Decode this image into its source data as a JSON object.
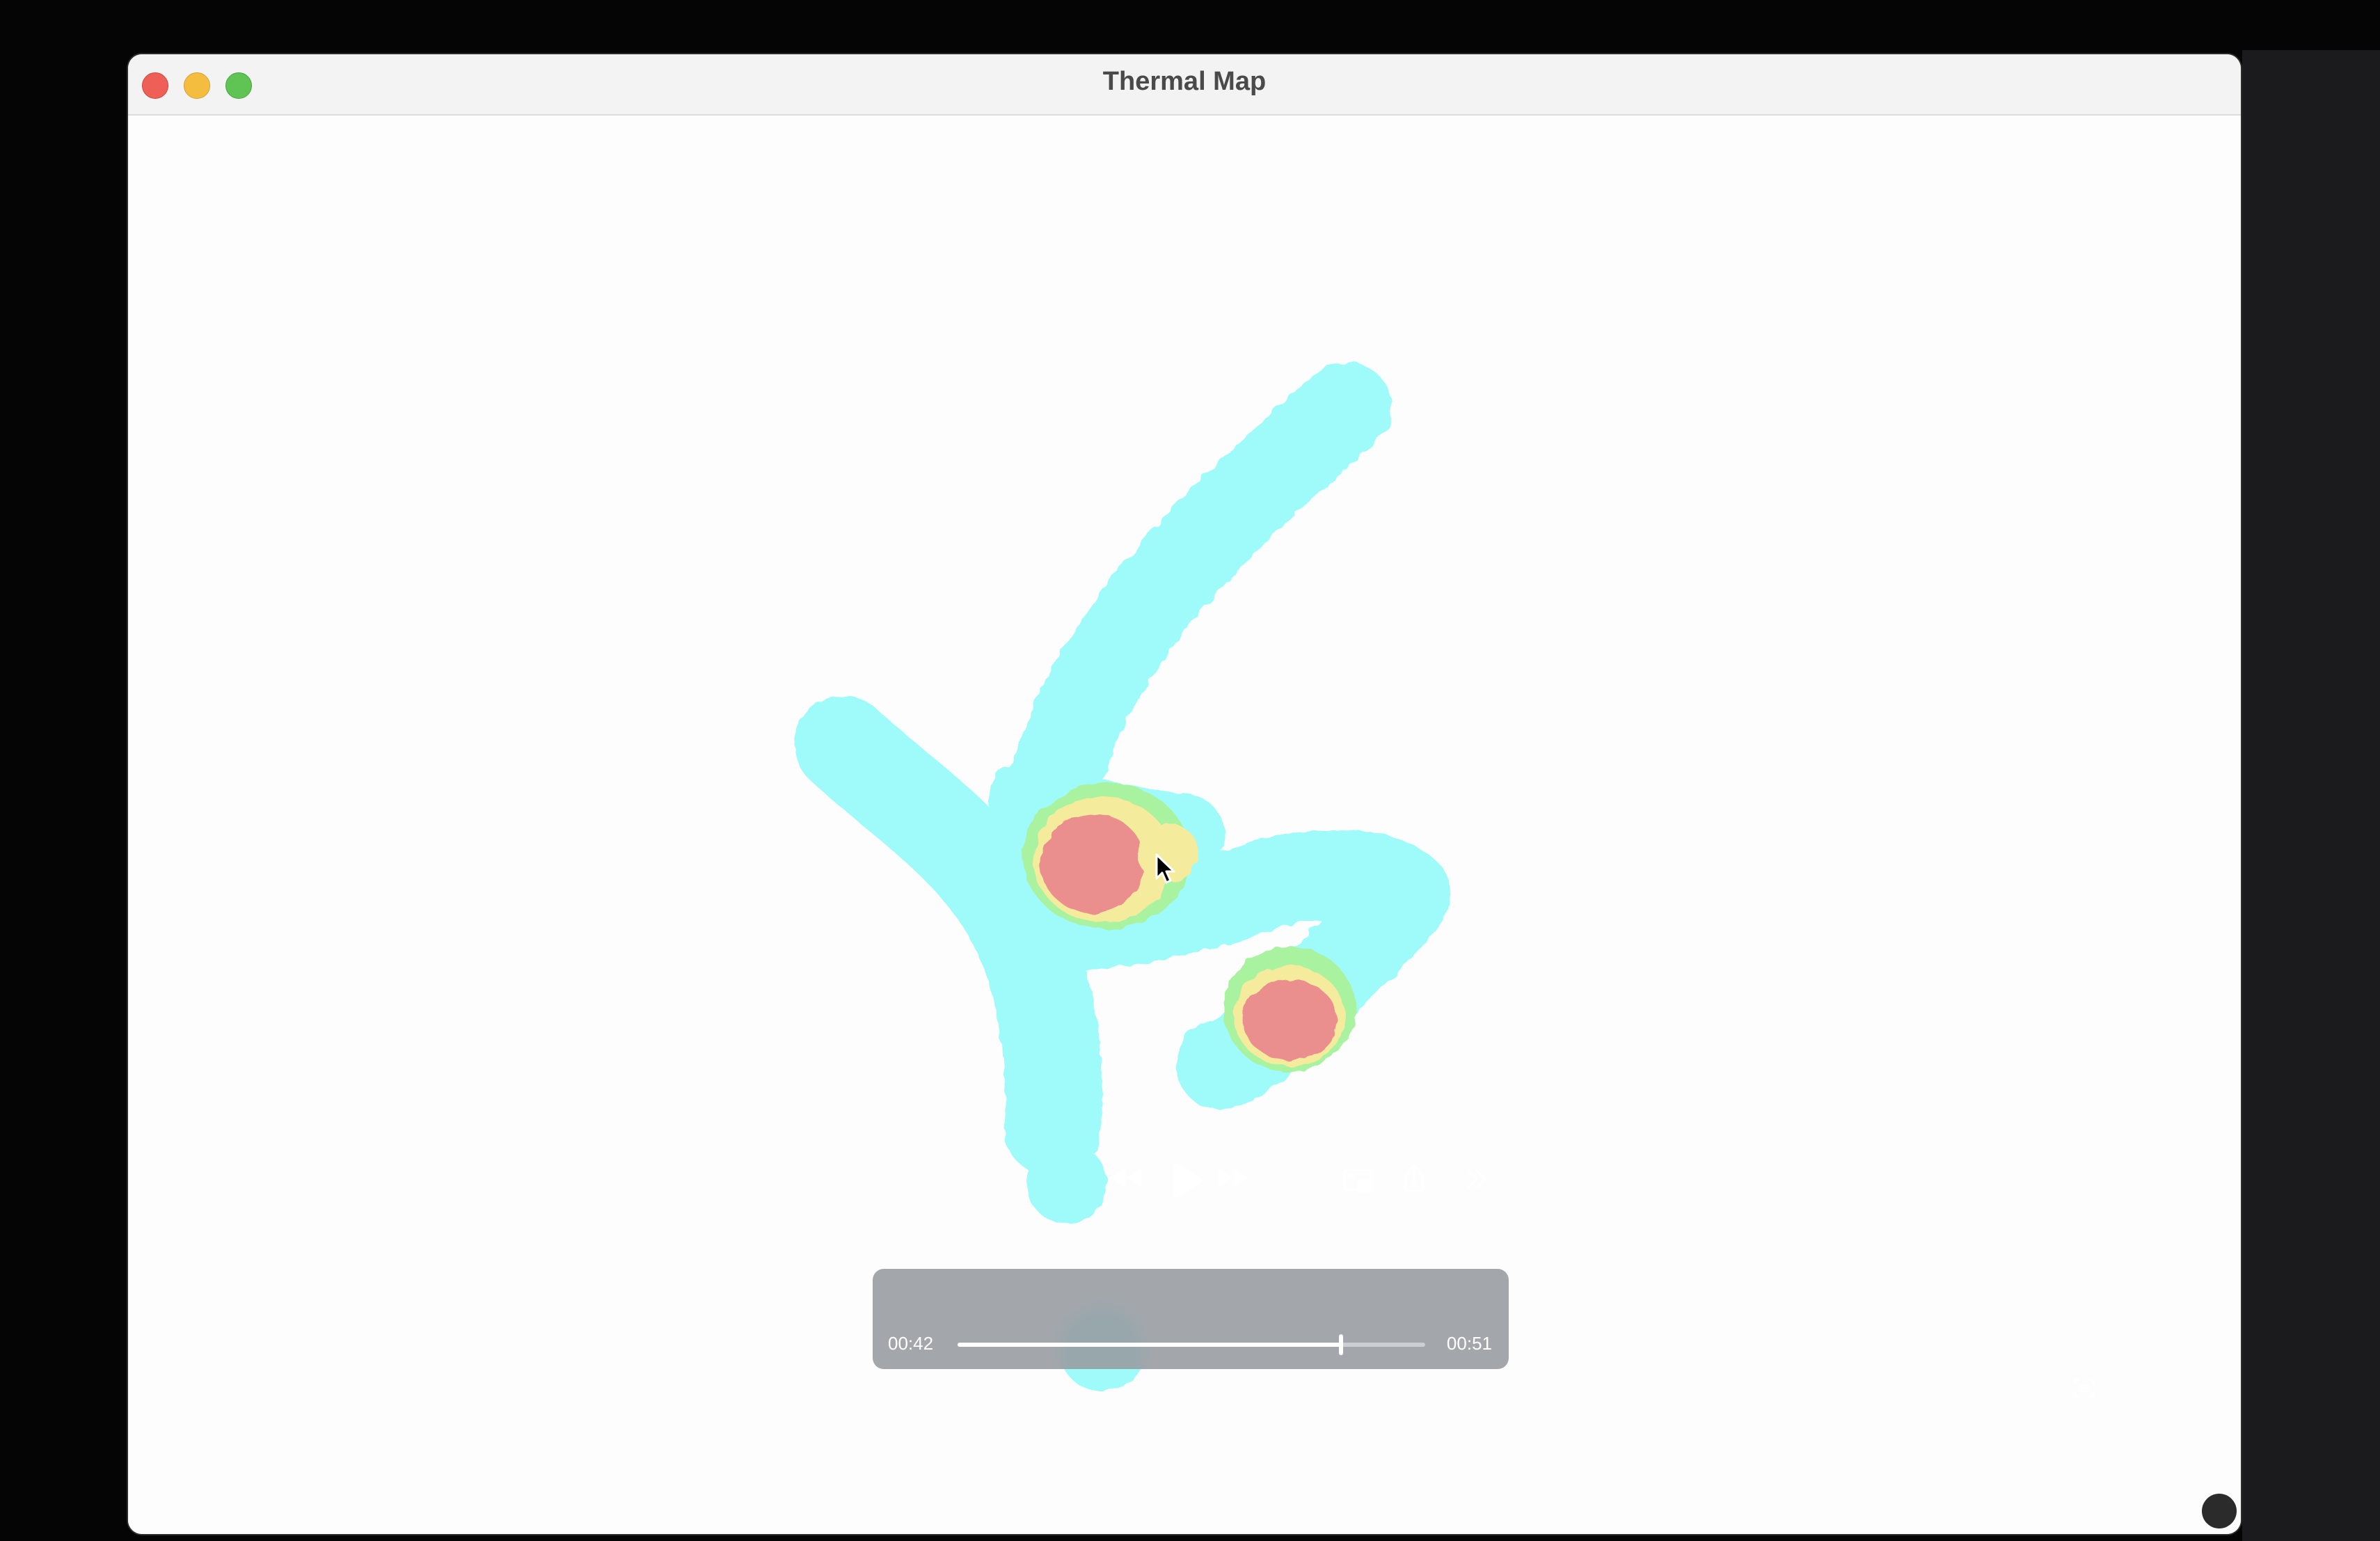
{
  "window": {
    "title": "Thermal Map"
  },
  "player": {
    "current_time": "00:42",
    "duration": "00:51",
    "progress_fraction": 0.82
  },
  "heatmap": {
    "colors": {
      "cold": "#9ffbfa",
      "warm_green": "#a9f2a0",
      "warm_yellow": "#f4ec9c",
      "hot": "#ea8e8e"
    }
  },
  "icons": {
    "close": "close-icon",
    "minimize": "minimize-icon",
    "zoom": "zoom-icon",
    "rewind": "rewind-icon",
    "play": "play-icon",
    "fast_forward": "fast-forward-icon",
    "picture_in_picture": "picture-in-picture-icon",
    "share": "share-icon",
    "more": "chevron-double-right-icon",
    "live_text": "live-text-icon",
    "cursor": "mouse-pointer-icon"
  }
}
